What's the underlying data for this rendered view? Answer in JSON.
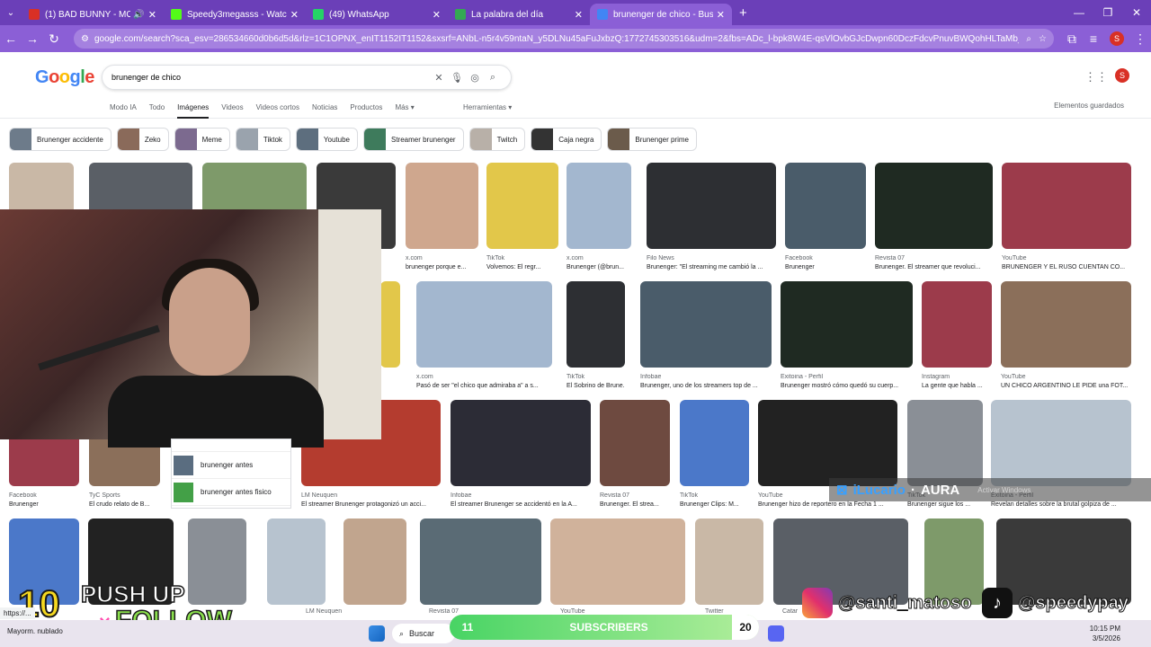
{
  "browser": {
    "tabs": [
      {
        "title": "(1) BAD BUNNY - MONACO",
        "color": "#d93025",
        "audio": true,
        "active": false
      },
      {
        "title": "Speedy3megasss - Watch the V",
        "color": "#53fc18",
        "audio": false,
        "active": false
      },
      {
        "title": "(49) WhatsApp",
        "color": "#25d366",
        "audio": false,
        "active": false
      },
      {
        "title": "La palabra del día",
        "color": "#34a853",
        "audio": false,
        "active": false
      },
      {
        "title": "brunenger de chico - Buscar co",
        "color": "#4285f4",
        "audio": false,
        "active": true
      }
    ],
    "new_tab": "+",
    "url": "google.com/search?sca_esv=286534660d0b6d5d&rlz=1C1OPNX_enIT1152IT1152&sxsrf=ANbL-n5r4v59ntaN_y5DLNu45aFuJxbzQ:1772745303516&udm=2&fbs=ADc_l-bpk8W4E-qsVlOvbGJcDwpn60DczFdcvPnuvBWQohHLTaMb_WtLz8zQ41...",
    "profile_initial": "S"
  },
  "google": {
    "logo": "Google",
    "query": "brunenger de chico",
    "nav": [
      "Modo IA",
      "Todo",
      "Imágenes",
      "Videos",
      "Videos cortos",
      "Noticias",
      "Productos",
      "Más ▾"
    ],
    "active_nav": "Imágenes",
    "tools": "Herramientas ▾",
    "saved": "Elementos guardados",
    "chips": [
      "Brunenger accidente",
      "Zeko",
      "Meme",
      "Tiktok",
      "Youtube",
      "Streamer brunenger",
      "Twitch",
      "Caja negra",
      "Brunenger prime"
    ],
    "results": [
      {
        "source": "x.com",
        "title": "brunenger porque e..."
      },
      {
        "source": "TikTok",
        "title": "Volvemos: El regr..."
      },
      {
        "source": "x.com",
        "title": "Brunenger (@brun..."
      },
      {
        "source": "Filo News",
        "title": "Brunenger: \"El streaming me cambió la ..."
      },
      {
        "source": "Facebook",
        "title": "Brunenger"
      },
      {
        "source": "Revista 07",
        "title": "Brunenger. El streamer que revoluci..."
      },
      {
        "source": "YouTube",
        "title": "BRUNENGER Y EL RUSO CUENTAN CO..."
      },
      {
        "source": "x.com",
        "title": "Pasó de ser \"el chico que admiraba a\" a s..."
      },
      {
        "source": "TikTok",
        "title": "El Sobrino de Brune..."
      },
      {
        "source": "Infobae",
        "title": "Brunenger, uno de los streamers top de ..."
      },
      {
        "source": "Exitoina - Perfil",
        "title": "Brunenger mostró cómo quedó su cuerp..."
      },
      {
        "source": "Instagram",
        "title": "La gente que habla ..."
      },
      {
        "source": "YouTube",
        "title": "UN CHICO ARGENTINO LE PIDE una FOT..."
      },
      {
        "source": "Facebook",
        "title": "Brunenger"
      },
      {
        "source": "TyC Sports",
        "title": "El crudo relato de B..."
      },
      {
        "source": "LM Neuquen",
        "title": "El streamer Brunenger protagonizó un acci..."
      },
      {
        "source": "Infobae",
        "title": "El streamer Brunenger se accidentó en la A..."
      },
      {
        "source": "Revista 07",
        "title": "Brunenger. El strea..."
      },
      {
        "source": "TikTok",
        "title": "Brunenger Clips: M..."
      },
      {
        "source": "YouTube",
        "title": "Brunenger hizo de reportero en la Fecha 1 ..."
      },
      {
        "source": "TikTok",
        "title": "Brunenger sigue los ..."
      },
      {
        "source": "Exitoina - Perfil",
        "title": "Revelan detalles sobre la brutal golpiza de ..."
      }
    ],
    "bottom_sources": [
      "LM Neuquen",
      "Revista 07",
      "YouTube",
      "Twitter",
      "Catar"
    ],
    "related": [
      "brunenger antes",
      "brunenger antes fisico"
    ]
  },
  "overlay": {
    "push_num": "10",
    "push_text": "PUSH UP",
    "follow_text": "FOLLOW",
    "follow_x": "×",
    "instagram": "@santi_matoso",
    "tiktok": "@speedypay",
    "aura_name": "iLucario",
    "aura_text": "AURA",
    "subs_left": "11",
    "subs_label": "SUBSCRIBERS",
    "subs_right": "20",
    "activate": "Activar Windows"
  },
  "taskbar": {
    "weather": "Mayorm. nublado",
    "search": "Buscar",
    "time": "10:15 PM",
    "date": "3/5/2026"
  },
  "status_url": "https://..."
}
